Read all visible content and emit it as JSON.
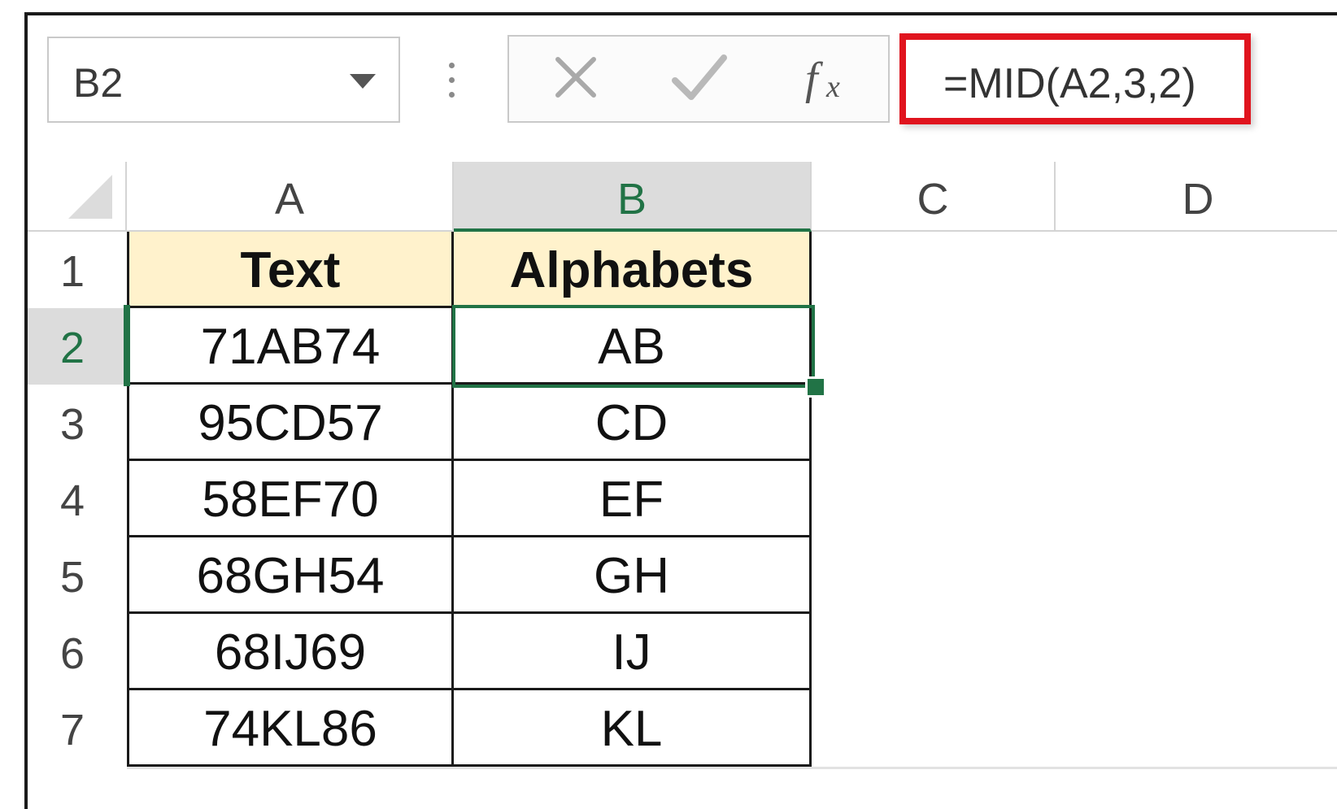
{
  "formula_bar": {
    "name_box": "B2",
    "formula": "=MID(A2,3,2)",
    "cancel_icon": "close-icon",
    "enter_icon": "checkmark-icon",
    "function_icon": "fx-icon"
  },
  "grid": {
    "columns": [
      "A",
      "B",
      "C",
      "D"
    ],
    "active_column": "B",
    "rows": [
      "1",
      "2",
      "3",
      "4",
      "5",
      "6",
      "7"
    ],
    "active_row": "2",
    "header_row": {
      "a": "Text",
      "b": "Alphabets"
    },
    "data": [
      {
        "a": "71AB74",
        "b": "AB"
      },
      {
        "a": "95CD57",
        "b": "CD"
      },
      {
        "a": "58EF70",
        "b": "EF"
      },
      {
        "a": "68GH54",
        "b": "GH"
      },
      {
        "a": "68IJ69",
        "b": "IJ"
      },
      {
        "a": "74KL86",
        "b": "KL"
      }
    ]
  },
  "colors": {
    "accent": "#217346",
    "highlight": "#e0141e",
    "header_fill": "#fff2cc"
  }
}
